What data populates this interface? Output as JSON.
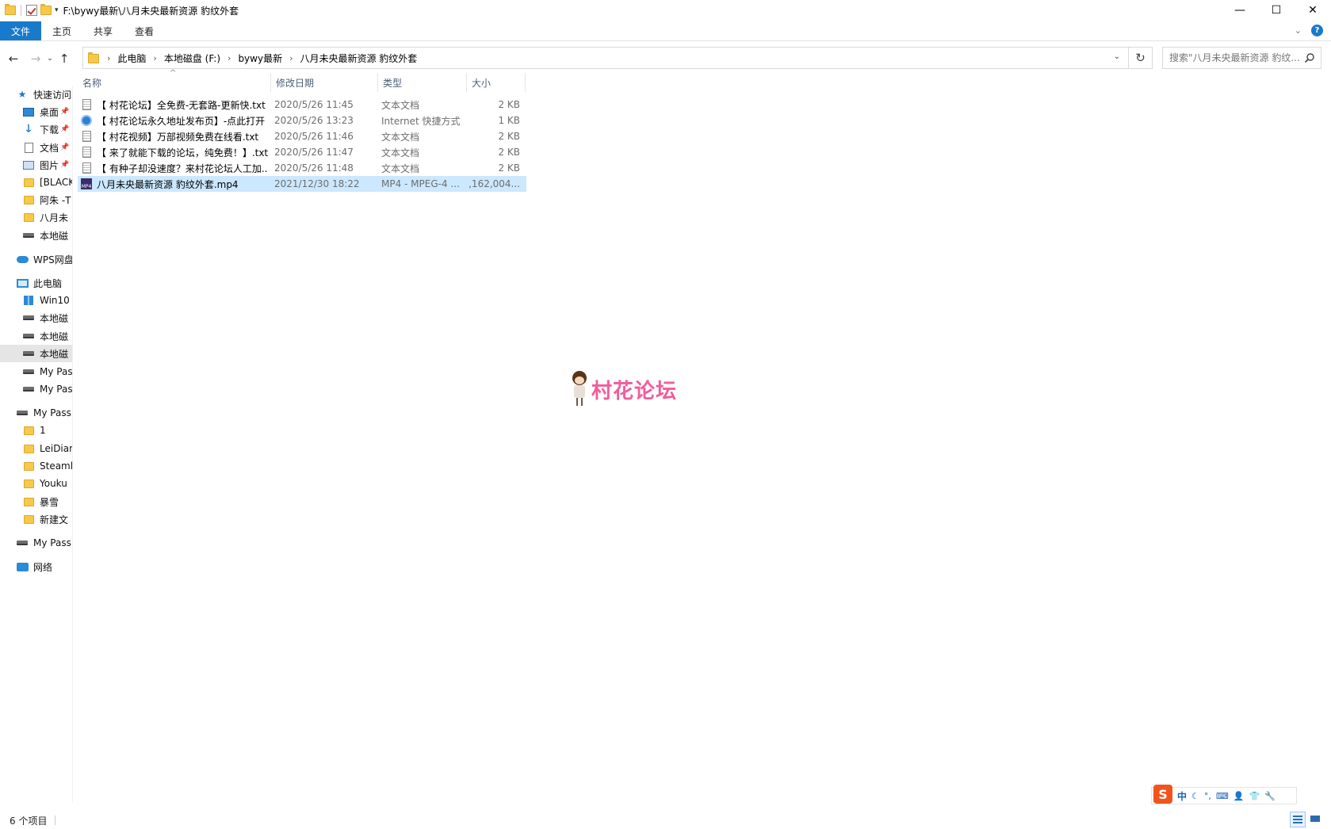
{
  "window": {
    "title": "F:\\bywy最新\\八月未央最新资源 豹纹外套",
    "controls": [
      "—",
      "☐",
      "✕"
    ]
  },
  "ribbon": {
    "tabs": [
      "文件",
      "主页",
      "共享",
      "查看"
    ]
  },
  "address": {
    "crumbs": [
      "此电脑",
      "本地磁盘 (F:)",
      "bywy最新",
      "八月未央最新资源 豹纹外套"
    ]
  },
  "search": {
    "placeholder": "搜索\"八月未央最新资源 豹纹..."
  },
  "sidebar": {
    "items": [
      {
        "label": "快速访问",
        "icon": "star-icon"
      },
      {
        "label": "桌面",
        "icon": "desktop-icon"
      },
      {
        "label": "下载",
        "icon": "download-icon"
      },
      {
        "label": "文档",
        "icon": "document-icon"
      },
      {
        "label": "图片",
        "icon": "pictures-icon"
      },
      {
        "label": "[BLACK",
        "icon": "folder-icon"
      },
      {
        "label": "阿朱 -T",
        "icon": "folder-icon"
      },
      {
        "label": "八月未",
        "icon": "folder-icon"
      },
      {
        "label": "本地磁",
        "icon": "drive-icon"
      },
      {
        "label": "WPS网盘",
        "icon": "cloud-icon"
      },
      {
        "label": "此电脑",
        "icon": "computer-icon"
      },
      {
        "label": "Win10",
        "icon": "windows-drive-icon"
      },
      {
        "label": "本地磁",
        "icon": "drive-icon"
      },
      {
        "label": "本地磁",
        "icon": "drive-icon"
      },
      {
        "label": "本地磁",
        "icon": "drive-icon"
      },
      {
        "label": "My Pas",
        "icon": "drive-icon"
      },
      {
        "label": "My Pas",
        "icon": "drive-icon"
      },
      {
        "label": "My Pass",
        "icon": "drive-icon"
      },
      {
        "label": "1",
        "icon": "folder-icon"
      },
      {
        "label": "LeiDian",
        "icon": "folder-icon"
      },
      {
        "label": "Steaml",
        "icon": "folder-icon"
      },
      {
        "label": "Youku",
        "icon": "folder-icon"
      },
      {
        "label": "暴雪",
        "icon": "folder-icon"
      },
      {
        "label": "新建文",
        "icon": "folder-icon"
      },
      {
        "label": "My Pass",
        "icon": "drive-icon"
      },
      {
        "label": "网络",
        "icon": "network-icon"
      }
    ]
  },
  "columns": {
    "name": "名称",
    "date": "修改日期",
    "type": "类型",
    "size": "大小"
  },
  "files": [
    {
      "name": "【 村花论坛】全免费-无套路-更新快.txt",
      "date": "2020/5/26 11:45",
      "type": "文本文档",
      "size": "2 KB",
      "icon": "text-file-icon"
    },
    {
      "name": "【 村花论坛永久地址发布页】-点此打开",
      "date": "2020/5/26 13:23",
      "type": "Internet 快捷方式",
      "size": "1 KB",
      "icon": "internet-shortcut-icon"
    },
    {
      "name": "【 村花视频】万部视频免费在线看.txt",
      "date": "2020/5/26 11:46",
      "type": "文本文档",
      "size": "2 KB",
      "icon": "text-file-icon"
    },
    {
      "name": "【 来了就能下载的论坛，纯免费！】.txt",
      "date": "2020/5/26 11:47",
      "type": "文本文档",
      "size": "2 KB",
      "icon": "text-file-icon"
    },
    {
      "name": "【 有种子却没速度？来村花论坛人工加...",
      "date": "2020/5/26 11:48",
      "type": "文本文档",
      "size": "2 KB",
      "icon": "text-file-icon"
    },
    {
      "name": "八月未央最新资源 豹纹外套.mp4",
      "date": "2021/12/30 18:22",
      "type": "MP4 - MPEG-4 ...",
      "size": "1,162,004...",
      "icon": "video-file-icon"
    }
  ],
  "watermark": {
    "text": "村花论坛"
  },
  "ime": {
    "logo": "S",
    "mode": "中"
  },
  "status": {
    "count": "6 个项目"
  }
}
